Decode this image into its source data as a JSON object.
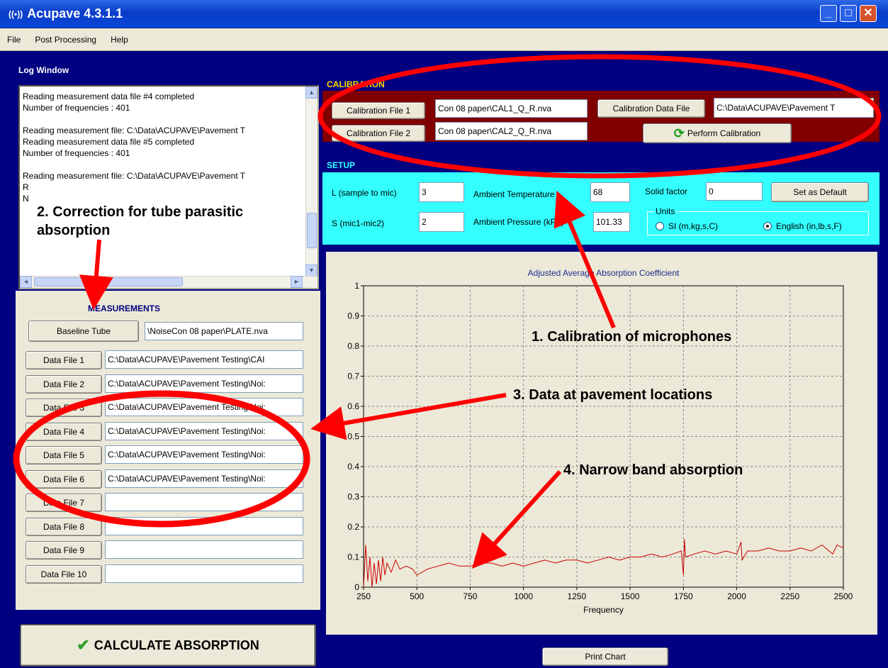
{
  "window": {
    "title": "Acupave 4.3.1.1",
    "minimize": "_",
    "maximize": "□",
    "close": "✕"
  },
  "menu": [
    "File",
    "Post Processing",
    "Help"
  ],
  "log": {
    "title": "Log Window",
    "text": "Reading measurement data file #4 completed\nNumber of frequencies : 401\n\nReading measurement file: C:\\Data\\ACUPAVE\\Pavement T\nReading measurement data file #5 completed\nNumber of frequencies : 401\n\nReading measurement file: C:\\Data\\ACUPAVE\\Pavement T\nR\nN",
    "scroll_up": "▲",
    "scroll_down": "▼",
    "scroll_left": "◄",
    "scroll_right": "►"
  },
  "calibration": {
    "title": "CALIBRATION",
    "file1_btn": "Calibration File 1",
    "file1": "Con 08 paper\\CAL1_Q_R.nva",
    "file2_btn": "Calibration File 2",
    "file2": "Con 08 paper\\CAL2_Q_R.nva",
    "data_btn": "Calibration Data File",
    "data_file": "C:\\Data\\ACUPAVE\\Pavement T",
    "perform_btn": "Perform Calibration"
  },
  "setup": {
    "title": "SETUP",
    "l_label": "L (sample to mic)",
    "l_value": "3",
    "s_label": "S (mic1-mic2)",
    "s_value": "2",
    "temp_label": "Ambient Temperature",
    "temp_value": "68",
    "press_label": "Ambient Pressure (kPa)",
    "press_value": "101.33",
    "solid_label": "Solid factor",
    "solid_value": "0",
    "default_btn": "Set as Default",
    "units_label": "Units",
    "units_si": "SI (m,kg,s,C)",
    "units_en": "English (in,lb,s,F)"
  },
  "measurements": {
    "title": "MEASUREMENTS",
    "baseline_btn": "Baseline Tube",
    "baseline_file": "\\NoiseCon 08 paper\\PLATE.nva",
    "rows": [
      {
        "label": "Data File 1",
        "file": "C:\\Data\\ACUPAVE\\Pavement Testing\\CAI"
      },
      {
        "label": "Data File 2",
        "file": "C:\\Data\\ACUPAVE\\Pavement Testing\\Noi:"
      },
      {
        "label": "Data File 3",
        "file": "C:\\Data\\ACUPAVE\\Pavement Testing\\Noi:"
      },
      {
        "label": "Data File 4",
        "file": "C:\\Data\\ACUPAVE\\Pavement Testing\\Noi:"
      },
      {
        "label": "Data File 5",
        "file": "C:\\Data\\ACUPAVE\\Pavement Testing\\Noi:"
      },
      {
        "label": "Data File 6",
        "file": "C:\\Data\\ACUPAVE\\Pavement Testing\\Noi:"
      },
      {
        "label": "Data File 7",
        "file": ""
      },
      {
        "label": "Data File 8",
        "file": ""
      },
      {
        "label": "Data File 9",
        "file": ""
      },
      {
        "label": "Data File 10",
        "file": ""
      }
    ],
    "calc_btn": "CALCULATE ABSORPTION"
  },
  "print_btn": "Print Chart",
  "annotations": {
    "a1": "1. Calibration of microphones",
    "a2": "2.  Correction for tube parasitic absorption",
    "a3": "3.  Data at pavement locations",
    "a4": "4.  Narrow band absorption"
  },
  "colors": {
    "app_bg": "#000080",
    "calibration_bg": "#800000",
    "setup_bg": "#33ffff",
    "series": "#cc0000",
    "annotation": "#ff0000"
  },
  "chart_data": {
    "type": "line",
    "title": "Adjusted Average Absorption Coefficient",
    "xlabel": "Frequency",
    "ylabel": "",
    "xlim": [
      250,
      2500
    ],
    "ylim": [
      0,
      1
    ],
    "xticks": [
      250,
      500,
      750,
      1000,
      1250,
      1500,
      1750,
      2000,
      2250,
      2500
    ],
    "yticks": [
      0,
      0.1,
      0.2,
      0.3,
      0.4,
      0.5,
      0.6,
      0.7,
      0.8,
      0.9,
      1
    ],
    "grid": true,
    "series": [
      {
        "name": "",
        "color": "#cc0000",
        "x": [
          250,
          260,
          270,
          280,
          290,
          300,
          310,
          320,
          330,
          340,
          350,
          360,
          380,
          400,
          420,
          450,
          480,
          500,
          550,
          600,
          650,
          700,
          750,
          800,
          850,
          900,
          950,
          1000,
          1050,
          1100,
          1150,
          1200,
          1250,
          1300,
          1350,
          1400,
          1450,
          1500,
          1550,
          1600,
          1650,
          1700,
          1740,
          1750,
          1755,
          1760,
          1800,
          1850,
          1900,
          1950,
          2000,
          2020,
          2025,
          2050,
          2100,
          2150,
          2200,
          2250,
          2300,
          2350,
          2400,
          2450,
          2470,
          2500
        ],
        "y": [
          0.0,
          0.14,
          0.02,
          0.1,
          0.0,
          0.08,
          0.01,
          0.09,
          0.02,
          0.1,
          0.04,
          0.08,
          0.05,
          0.09,
          0.06,
          0.07,
          0.06,
          0.04,
          0.06,
          0.07,
          0.08,
          0.07,
          0.07,
          0.08,
          0.08,
          0.07,
          0.08,
          0.07,
          0.08,
          0.09,
          0.08,
          0.09,
          0.09,
          0.08,
          0.09,
          0.1,
          0.09,
          0.1,
          0.1,
          0.11,
          0.1,
          0.11,
          0.12,
          0.04,
          0.16,
          0.1,
          0.11,
          0.12,
          0.11,
          0.12,
          0.11,
          0.15,
          0.09,
          0.12,
          0.12,
          0.13,
          0.12,
          0.12,
          0.13,
          0.12,
          0.14,
          0.11,
          0.14,
          0.13
        ]
      }
    ]
  }
}
